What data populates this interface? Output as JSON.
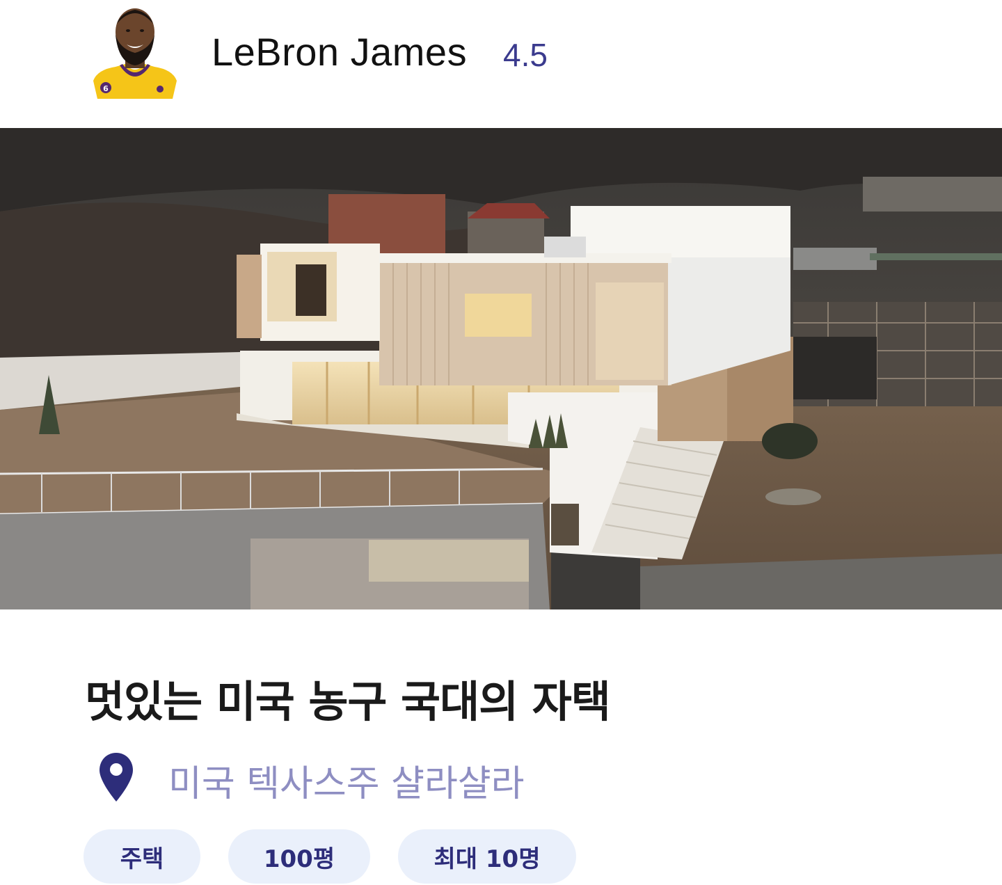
{
  "host": {
    "name": "LeBron James",
    "rating": "4.5",
    "jersey_number": "6"
  },
  "listing": {
    "title": "멋있는 미국 농구 국대의 자택",
    "location": "미국 텍사스주 샬라샬라",
    "tags": [
      "주택",
      "100평",
      "최대 10명"
    ]
  },
  "colors": {
    "rating": "#3b3b8e",
    "location_text": "#8e8ec2",
    "pin": "#2d2d7a",
    "chip_bg": "#eaf0fb",
    "chip_text": "#2d2d7a"
  },
  "icons": {
    "location": "map-pin-icon",
    "avatar": "host-avatar"
  }
}
